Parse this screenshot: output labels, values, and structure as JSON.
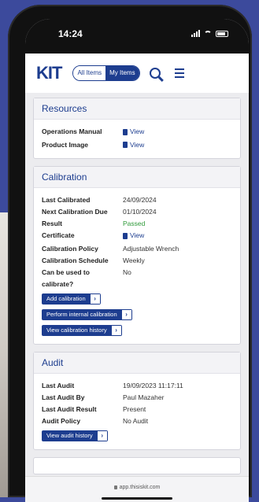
{
  "status_bar": {
    "time": "14:24"
  },
  "header": {
    "logo": "KIT",
    "toggle_all": "All Items",
    "toggle_my": "My Items"
  },
  "resources": {
    "title": "Resources",
    "rows": [
      {
        "label": "Operations Manual",
        "value": "View"
      },
      {
        "label": "Product Image",
        "value": "View"
      }
    ]
  },
  "calibration": {
    "title": "Calibration",
    "rows": [
      {
        "label": "Last Calibrated",
        "value": "24/09/2024"
      },
      {
        "label": "Next Calibration Due",
        "value": "01/10/2024"
      },
      {
        "label": "Result",
        "value": "Passed"
      },
      {
        "label": "Certificate",
        "value": "View"
      },
      {
        "label": "Calibration Policy",
        "value": "Adjustable Wrench"
      },
      {
        "label": "Calibration Schedule",
        "value": "Weekly"
      },
      {
        "label": "Can be used to calibrate?",
        "value": "No"
      }
    ],
    "buttons": {
      "add": "Add calibration",
      "internal": "Perform internal calibration",
      "history": "View calibration history"
    }
  },
  "audit": {
    "title": "Audit",
    "rows": [
      {
        "label": "Last Audit",
        "value": "19/09/2023 11:17:11"
      },
      {
        "label": "Last Audit By",
        "value": "Paul Mazaher"
      },
      {
        "label": "Last Audit Result",
        "value": "Present"
      },
      {
        "label": "Audit Policy",
        "value": "No Audit"
      }
    ],
    "buttons": {
      "history": "View audit history"
    }
  },
  "browser": {
    "url": "app.thisiskit.com"
  },
  "icons": {
    "search": "search-icon",
    "menu": "hamburger-menu-icon",
    "document": "document-icon",
    "arrow": "chevron-right-icon"
  },
  "colors": {
    "brand": "#1d3d8f",
    "passed": "#2f9a3a",
    "background": "#3c4a9c"
  }
}
